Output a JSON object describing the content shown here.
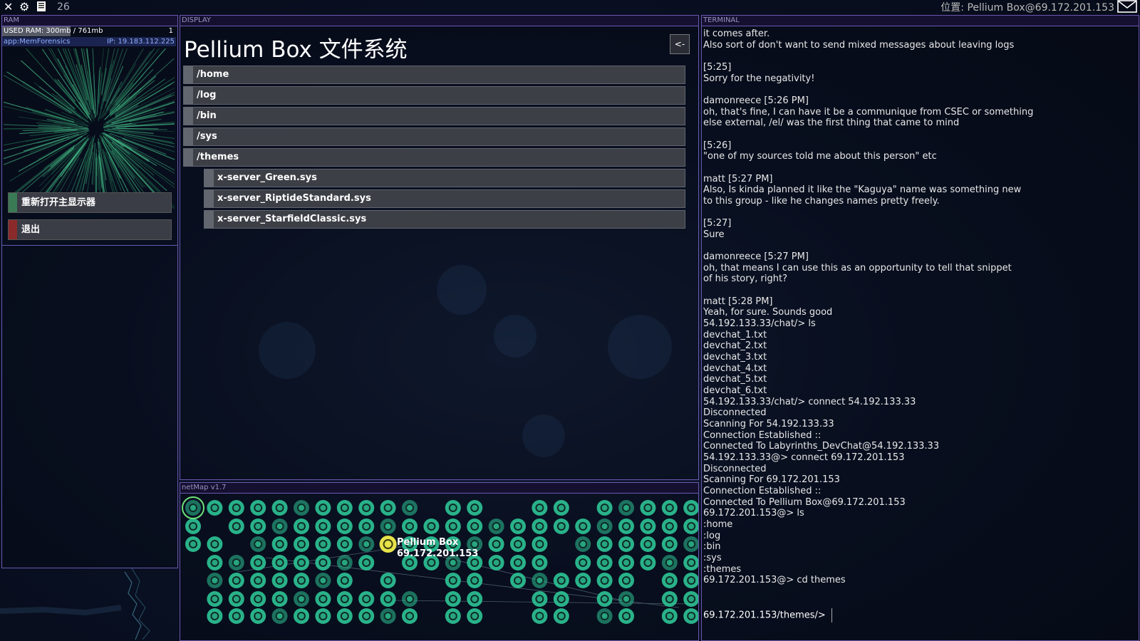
{
  "topbar": {
    "icons": [
      "close-icon",
      "gear-icon",
      "save-icon"
    ],
    "count": "26",
    "location": "位置: Pellium Box@69.172.201.153"
  },
  "ram": {
    "header": "RAM",
    "used": "USED RAM: 300mb / 761mb",
    "used_fraction": 0.394,
    "count": "1",
    "app_name": "app:MemForensics",
    "app_ip": "IP: 19.183.112.225",
    "buttons": [
      {
        "label": "重新打开主显示器",
        "color": "#3a7a55"
      },
      {
        "label": "退出",
        "color": "#8a2a2a"
      }
    ]
  },
  "display": {
    "header": "DISPLAY",
    "title": "Pellium Box 文件系统",
    "back": "<-",
    "folders": [
      "/home",
      "/log",
      "/bin",
      "/sys",
      "/themes"
    ],
    "files": [
      "x-server_Green.sys",
      "x-server_RiptideStandard.sys",
      "x-server_StarfieldClassic.sys"
    ]
  },
  "netmap": {
    "header": "netMap v1.7",
    "selected_name": "Pellium Box",
    "selected_ip": "69.172.201.153",
    "node_color": "#2ec496",
    "selected_color": "#e6e24a"
  },
  "terminal": {
    "header": "TERMINAL",
    "lines": [
      "it comes after.",
      "Also sort of don't want to send mixed messages about leaving logs",
      "",
      "[5:25]",
      "Sorry for the negativity!",
      "",
      "damonreece [5:26 PM]",
      "oh, that's fine, I can have it be a communique from CSEC or something",
      "else external, /el/ was the first thing that came to mind",
      "",
      "[5:26]",
      "\"one of my sources told me about this person\" etc",
      "",
      "matt [5:27 PM]",
      "Also, Is kinda planned it like the \"Kaguya\" name was something new",
      "to this group - like he changes names pretty freely.",
      "",
      "[5:27]",
      "Sure",
      "",
      "damonreece [5:27 PM]",
      "oh, that means I can use this as an opportunity to tell that snippet",
      "of his story, right?",
      "",
      "matt [5:28 PM]",
      "Yeah, for sure. Sounds good",
      "54.192.133.33/chat/> ls",
      "devchat_1.txt",
      "devchat_2.txt",
      "devchat_3.txt",
      "devchat_4.txt",
      "devchat_5.txt",
      "devchat_6.txt",
      "54.192.133.33/chat/> connect 54.192.133.33",
      "Disconnected",
      "Scanning For 54.192.133.33",
      "Connection Established ::",
      "Connected To Labyrinths_DevChat@54.192.133.33",
      "54.192.133.33@> connect 69.172.201.153",
      "Disconnected",
      "Scanning For 69.172.201.153",
      "Connection Established ::",
      "Connected To Pellium Box@69.172.201.153",
      "69.172.201.153@> ls",
      ":home",
      ":log",
      ":bin",
      ":sys",
      ":themes",
      "69.172.201.153@> cd themes"
    ],
    "prompt": "69.172.201.153/themes/>"
  }
}
